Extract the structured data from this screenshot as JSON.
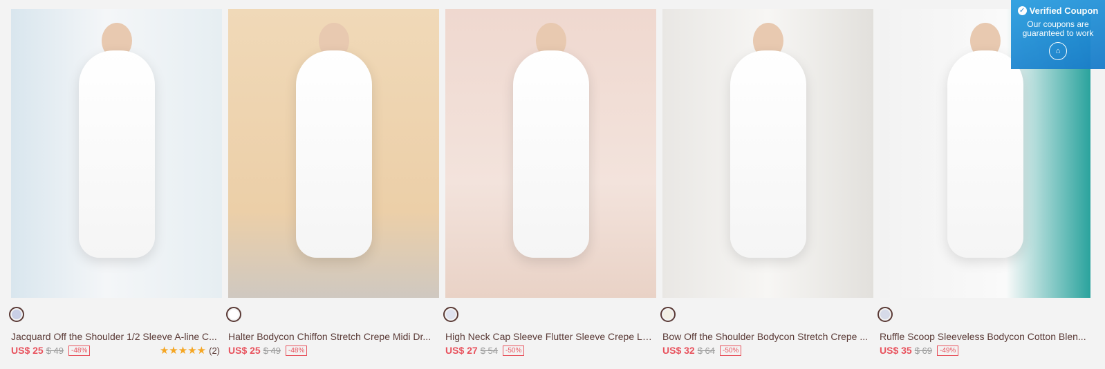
{
  "products": [
    {
      "title": "Jacquard Off the Shoulder 1/2 Sleeve A-line C...",
      "price": "US$ 25",
      "old_price": "$ 49",
      "discount": "-48%",
      "swatch_color": "#c9cfe6",
      "rating_count": "(2)"
    },
    {
      "title": "Halter Bodycon Chiffon Stretch Crepe Midi Dr...",
      "price": "US$ 25",
      "old_price": "$ 49",
      "discount": "-48%",
      "swatch_color": "#ffffff"
    },
    {
      "title": "High Neck Cap Sleeve Flutter Sleeve Crepe La...",
      "price": "US$ 27",
      "old_price": "$ 54",
      "discount": "-50%",
      "swatch_color": "#dfe2ef"
    },
    {
      "title": "Bow Off the Shoulder Bodycon Stretch Crepe ...",
      "price": "US$ 32",
      "old_price": "$ 64",
      "discount": "-50%",
      "swatch_color": "#f2efe4"
    },
    {
      "title": "Ruffle Scoop Sleeveless Bodycon Cotton Blen...",
      "price": "US$ 35",
      "old_price": "$ 69",
      "discount": "-49%",
      "swatch_color": "#d6dae8"
    }
  ],
  "coupon": {
    "title": "Verified Coupon",
    "text": "Our coupons are guaranteed to work",
    "icon": "home-icon"
  },
  "stars_glyph": "★★★★★",
  "accent": "#e8525d"
}
